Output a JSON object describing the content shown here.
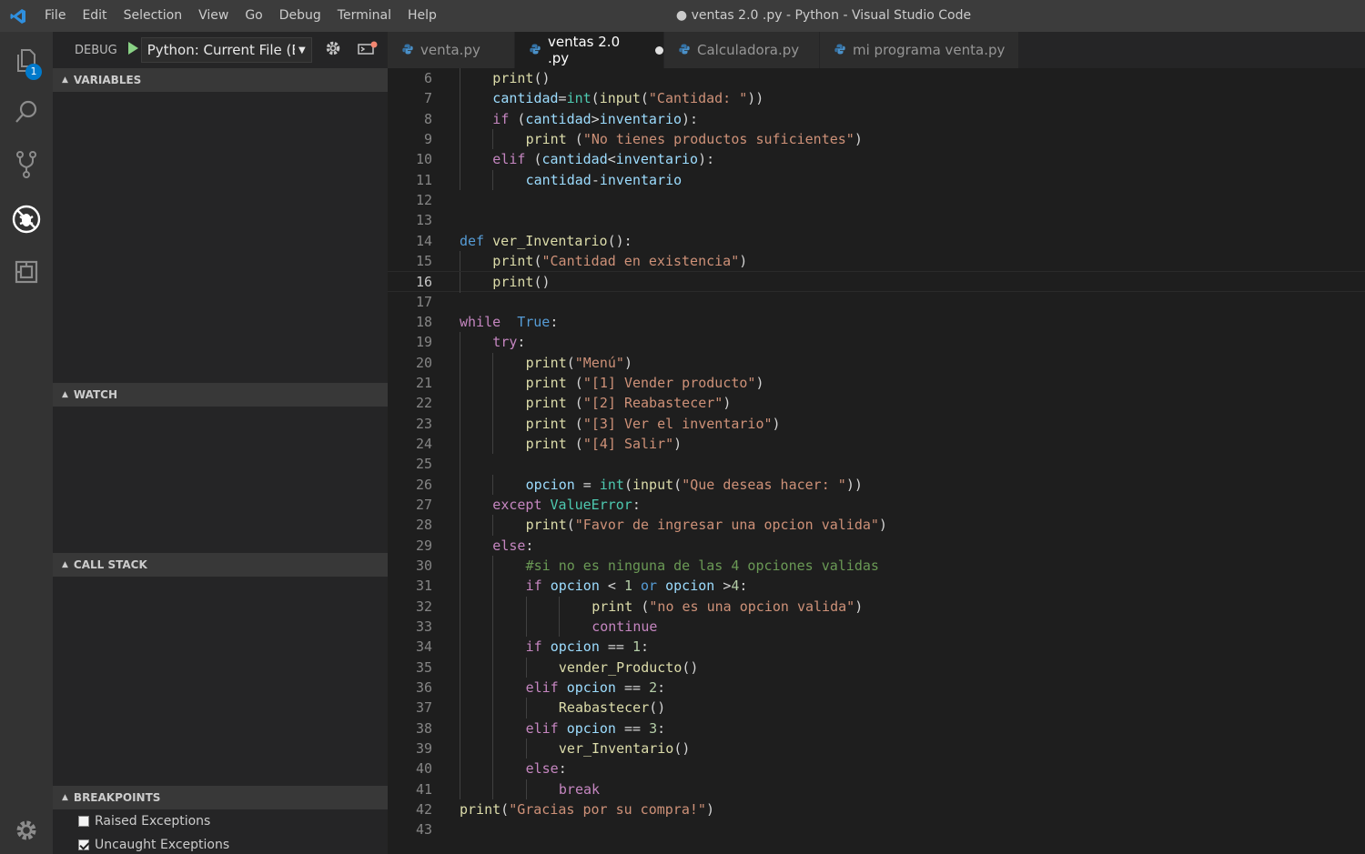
{
  "window": {
    "title": "● ventas 2.0 .py - Python - Visual Studio Code"
  },
  "menu": [
    "File",
    "Edit",
    "Selection",
    "View",
    "Go",
    "Debug",
    "Terminal",
    "Help"
  ],
  "activity": {
    "explorer_badge": "1"
  },
  "debug": {
    "label": "DEBUG",
    "config": "Python: Current File (E:"
  },
  "sections": {
    "variables": "VARIABLES",
    "watch": "WATCH",
    "call_stack": "CALL STACK",
    "breakpoints": "BREAKPOINTS"
  },
  "breakpoints": [
    {
      "label": "Raised Exceptions",
      "checked": false
    },
    {
      "label": "Uncaught Exceptions",
      "checked": true
    }
  ],
  "tabs": [
    {
      "label": "venta.py",
      "active": false
    },
    {
      "label": "ventas 2.0 .py",
      "active": true,
      "dirty": true
    },
    {
      "label": "Calculadora.py",
      "active": false
    },
    {
      "label": "mi programa venta.py",
      "active": false
    }
  ],
  "editor": {
    "current_line": 16,
    "lines": [
      {
        "n": 6,
        "indent": 1,
        "tokens": [
          [
            "fn",
            "print"
          ],
          [
            "pl",
            "()"
          ]
        ]
      },
      {
        "n": 7,
        "indent": 1,
        "tokens": [
          [
            "vr",
            "cantidad"
          ],
          [
            "pl",
            "="
          ],
          [
            "cls",
            "int"
          ],
          [
            "pl",
            "("
          ],
          [
            "fn",
            "input"
          ],
          [
            "pl",
            "("
          ],
          [
            "st",
            "\"Cantidad: \""
          ],
          [
            "pl",
            "))"
          ]
        ]
      },
      {
        "n": 8,
        "indent": 1,
        "tokens": [
          [
            "kw",
            "if"
          ],
          [
            "pl",
            " ("
          ],
          [
            "vr",
            "cantidad"
          ],
          [
            "pl",
            ">"
          ],
          [
            "vr",
            "inventario"
          ],
          [
            "pl",
            "):"
          ]
        ]
      },
      {
        "n": 9,
        "indent": 2,
        "tokens": [
          [
            "fn",
            "print"
          ],
          [
            "pl",
            " ("
          ],
          [
            "st",
            "\"No tienes productos suficientes\""
          ],
          [
            "pl",
            ")"
          ]
        ]
      },
      {
        "n": 10,
        "indent": 1,
        "tokens": [
          [
            "kw",
            "elif"
          ],
          [
            "pl",
            " ("
          ],
          [
            "vr",
            "cantidad"
          ],
          [
            "pl",
            "<"
          ],
          [
            "vr",
            "inventario"
          ],
          [
            "pl",
            "):"
          ]
        ]
      },
      {
        "n": 11,
        "indent": 2,
        "tokens": [
          [
            "vr",
            "cantidad"
          ],
          [
            "pl",
            "-"
          ],
          [
            "vr",
            "inventario"
          ]
        ]
      },
      {
        "n": 12,
        "indent": 0,
        "tokens": []
      },
      {
        "n": 13,
        "indent": 0,
        "tokens": []
      },
      {
        "n": 14,
        "indent": 0,
        "tokens": [
          [
            "kb",
            "def"
          ],
          [
            "pl",
            " "
          ],
          [
            "fn",
            "ver_Inventario"
          ],
          [
            "pl",
            "():"
          ]
        ]
      },
      {
        "n": 15,
        "indent": 1,
        "tokens": [
          [
            "fn",
            "print"
          ],
          [
            "pl",
            "("
          ],
          [
            "st",
            "\"Cantidad en existencia\""
          ],
          [
            "pl",
            ")"
          ]
        ]
      },
      {
        "n": 16,
        "indent": 1,
        "tokens": [
          [
            "fn",
            "print"
          ],
          [
            "pl",
            "()"
          ]
        ]
      },
      {
        "n": 17,
        "indent": 0,
        "tokens": []
      },
      {
        "n": 18,
        "indent": 0,
        "tokens": [
          [
            "kw",
            "while"
          ],
          [
            "pl",
            "  "
          ],
          [
            "kb",
            "True"
          ],
          [
            "pl",
            ":"
          ]
        ]
      },
      {
        "n": 19,
        "indent": 1,
        "tokens": [
          [
            "kw",
            "try"
          ],
          [
            "pl",
            ":"
          ]
        ]
      },
      {
        "n": 20,
        "indent": 2,
        "tokens": [
          [
            "fn",
            "print"
          ],
          [
            "pl",
            "("
          ],
          [
            "st",
            "\"Menú\""
          ],
          [
            "pl",
            ")"
          ]
        ]
      },
      {
        "n": 21,
        "indent": 2,
        "tokens": [
          [
            "fn",
            "print"
          ],
          [
            "pl",
            " ("
          ],
          [
            "st",
            "\"[1] Vender producto\""
          ],
          [
            "pl",
            ")"
          ]
        ]
      },
      {
        "n": 22,
        "indent": 2,
        "tokens": [
          [
            "fn",
            "print"
          ],
          [
            "pl",
            " ("
          ],
          [
            "st",
            "\"[2] Reabastecer\""
          ],
          [
            "pl",
            ")"
          ]
        ]
      },
      {
        "n": 23,
        "indent": 2,
        "tokens": [
          [
            "fn",
            "print"
          ],
          [
            "pl",
            " ("
          ],
          [
            "st",
            "\"[3] Ver el inventario\""
          ],
          [
            "pl",
            ")"
          ]
        ]
      },
      {
        "n": 24,
        "indent": 2,
        "tokens": [
          [
            "fn",
            "print"
          ],
          [
            "pl",
            " ("
          ],
          [
            "st",
            "\"[4] Salir\""
          ],
          [
            "pl",
            ")"
          ]
        ]
      },
      {
        "n": 25,
        "indent": 1,
        "tokens": []
      },
      {
        "n": 26,
        "indent": 2,
        "tokens": [
          [
            "vr",
            "opcion"
          ],
          [
            "pl",
            " = "
          ],
          [
            "cls",
            "int"
          ],
          [
            "pl",
            "("
          ],
          [
            "fn",
            "input"
          ],
          [
            "pl",
            "("
          ],
          [
            "st",
            "\"Que deseas hacer: \""
          ],
          [
            "pl",
            "))"
          ]
        ]
      },
      {
        "n": 27,
        "indent": 1,
        "tokens": [
          [
            "kw",
            "except"
          ],
          [
            "pl",
            " "
          ],
          [
            "cls",
            "ValueError"
          ],
          [
            "pl",
            ":"
          ]
        ]
      },
      {
        "n": 28,
        "indent": 2,
        "tokens": [
          [
            "fn",
            "print"
          ],
          [
            "pl",
            "("
          ],
          [
            "st",
            "\"Favor de ingresar una opcion valida\""
          ],
          [
            "pl",
            ")"
          ]
        ]
      },
      {
        "n": 29,
        "indent": 1,
        "tokens": [
          [
            "kw",
            "else"
          ],
          [
            "pl",
            ":"
          ]
        ]
      },
      {
        "n": 30,
        "indent": 2,
        "tokens": [
          [
            "cm",
            "#si no es ninguna de las 4 opciones validas"
          ]
        ]
      },
      {
        "n": 31,
        "indent": 2,
        "tokens": [
          [
            "kw",
            "if"
          ],
          [
            "pl",
            " "
          ],
          [
            "vr",
            "opcion"
          ],
          [
            "pl",
            " < "
          ],
          [
            "nm",
            "1"
          ],
          [
            "pl",
            " "
          ],
          [
            "kb",
            "or"
          ],
          [
            "pl",
            " "
          ],
          [
            "vr",
            "opcion"
          ],
          [
            "pl",
            " >"
          ],
          [
            "nm",
            "4"
          ],
          [
            "pl",
            ":"
          ]
        ]
      },
      {
        "n": 32,
        "indent": 4,
        "tokens": [
          [
            "fn",
            "print"
          ],
          [
            "pl",
            " ("
          ],
          [
            "st",
            "\"no es una opcion valida\""
          ],
          [
            "pl",
            ")"
          ]
        ]
      },
      {
        "n": 33,
        "indent": 4,
        "tokens": [
          [
            "kw",
            "continue"
          ]
        ]
      },
      {
        "n": 34,
        "indent": 2,
        "tokens": [
          [
            "kw",
            "if"
          ],
          [
            "pl",
            " "
          ],
          [
            "vr",
            "opcion"
          ],
          [
            "pl",
            " == "
          ],
          [
            "nm",
            "1"
          ],
          [
            "pl",
            ":"
          ]
        ]
      },
      {
        "n": 35,
        "indent": 3,
        "tokens": [
          [
            "fn",
            "vender_Producto"
          ],
          [
            "pl",
            "()"
          ]
        ]
      },
      {
        "n": 36,
        "indent": 2,
        "tokens": [
          [
            "kw",
            "elif"
          ],
          [
            "pl",
            " "
          ],
          [
            "vr",
            "opcion"
          ],
          [
            "pl",
            " == "
          ],
          [
            "nm",
            "2"
          ],
          [
            "pl",
            ":"
          ]
        ]
      },
      {
        "n": 37,
        "indent": 3,
        "tokens": [
          [
            "fn",
            "Reabastecer"
          ],
          [
            "pl",
            "()"
          ]
        ]
      },
      {
        "n": 38,
        "indent": 2,
        "tokens": [
          [
            "kw",
            "elif"
          ],
          [
            "pl",
            " "
          ],
          [
            "vr",
            "opcion"
          ],
          [
            "pl",
            " == "
          ],
          [
            "nm",
            "3"
          ],
          [
            "pl",
            ":"
          ]
        ]
      },
      {
        "n": 39,
        "indent": 3,
        "tokens": [
          [
            "fn",
            "ver_Inventario"
          ],
          [
            "pl",
            "()"
          ]
        ]
      },
      {
        "n": 40,
        "indent": 2,
        "tokens": [
          [
            "kw",
            "else"
          ],
          [
            "pl",
            ":"
          ]
        ]
      },
      {
        "n": 41,
        "indent": 3,
        "tokens": [
          [
            "kw",
            "break"
          ]
        ]
      },
      {
        "n": 42,
        "indent": 0,
        "tokens": [
          [
            "fn",
            "print"
          ],
          [
            "pl",
            "("
          ],
          [
            "st",
            "\"Gracias por su compra!\""
          ],
          [
            "pl",
            ")"
          ]
        ]
      },
      {
        "n": 43,
        "indent": 0,
        "tokens": []
      }
    ]
  }
}
